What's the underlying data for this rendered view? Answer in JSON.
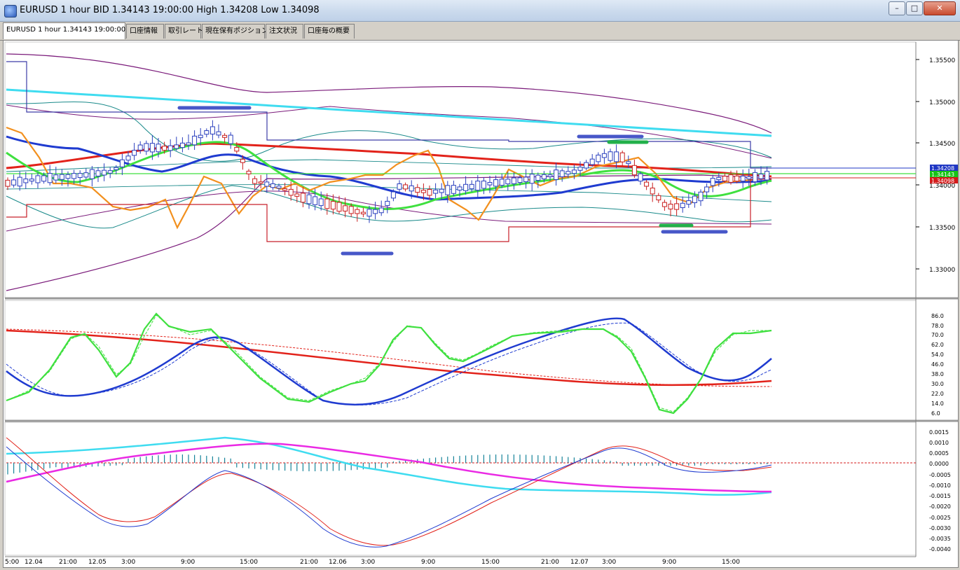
{
  "window": {
    "title": "EURUSD 1 hour BID 1.34143 19:00:00 High 1.34208 Low 1.34098",
    "buttons": [
      "–",
      "□",
      "✕"
    ]
  },
  "tabs": [
    {
      "label": "EURUSD 1 hour 1.34143 19:00:00",
      "active": true
    },
    {
      "label": "口座情報",
      "active": false
    },
    {
      "label": "取引レート",
      "active": false
    },
    {
      "label": "現在保有ポジション",
      "active": false
    },
    {
      "label": "注文状況",
      "active": false
    },
    {
      "label": "口座毎の概要",
      "active": false
    }
  ],
  "price_panel": {
    "ticks": [
      "1.35500",
      "1.35000",
      "1.34500",
      "1.34000",
      "1.33500",
      "1.33000"
    ],
    "current_labels": [
      "1.34208",
      "1.34143",
      "1.34098"
    ],
    "label_colors": [
      "#1f37c4",
      "#16c416",
      "#d41b1b"
    ]
  },
  "oscillator_panel": {
    "ticks": [
      "86.0",
      "78.0",
      "70.0",
      "62.0",
      "54.0",
      "46.0",
      "38.0",
      "30.0",
      "22.0",
      "14.0",
      "6.0"
    ]
  },
  "macd_panel": {
    "ticks": [
      "0.0015",
      "0.0010",
      "0.0005",
      "0.0000",
      "-0.0005",
      "-0.0010",
      "-0.0015",
      "-0.0020",
      "-0.0025",
      "-0.0030",
      "-0.0035",
      "-0.0040"
    ]
  },
  "time_axis": [
    "5:00",
    "12.04",
    "21:00",
    "12.05",
    "3:00",
    "9:00",
    "15:00",
    "21:00",
    "12.06",
    "3:00",
    "9:00",
    "15:00",
    "21:00",
    "12.07",
    "3:00",
    "9:00",
    "15:00"
  ],
  "colors": {
    "bull": "#2a3fbe",
    "bear": "#c81e1e",
    "green": "#3fe03f",
    "blue": "#1f3bd0",
    "red": "#e2221a",
    "cyan": "#3fdcf0",
    "orange": "#f2901e",
    "purple": "#7a1a7a",
    "teal": "#1a8a8a",
    "magenta": "#ea2ae4"
  }
}
